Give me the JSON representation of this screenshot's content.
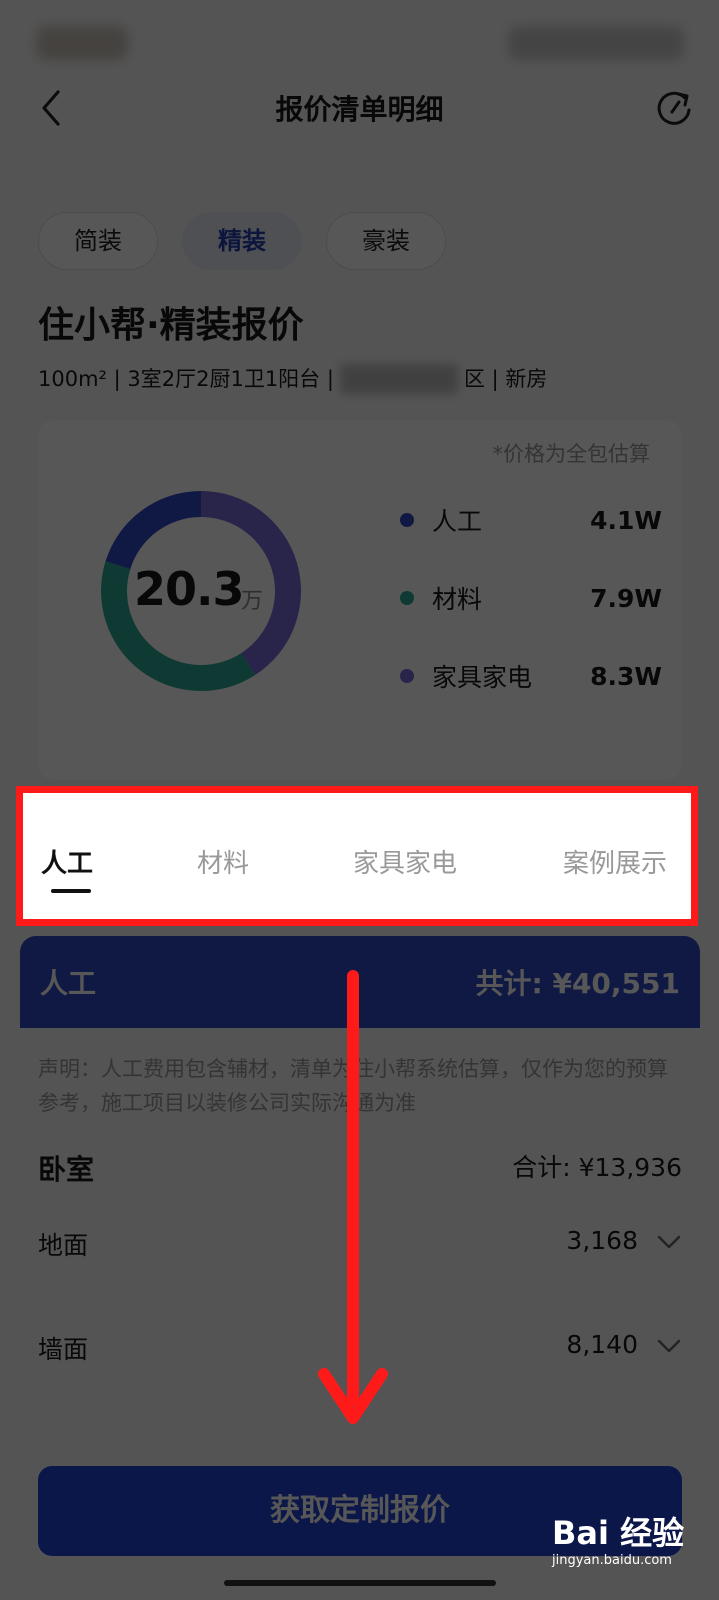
{
  "header": {
    "title": "报价清单明细"
  },
  "package_tabs": [
    {
      "label": "简装",
      "active": false
    },
    {
      "label": "精装",
      "active": true
    },
    {
      "label": "豪装",
      "active": false
    }
  ],
  "quote": {
    "title": "住小帮·精装报价",
    "area": "100m² | 3室2厅2厨1卫1阳台 |",
    "district_suffix": "区 | 新房"
  },
  "summary": {
    "note": "*价格为全包估算",
    "total_value": "20.3",
    "total_unit": "万",
    "legend": [
      {
        "name": "人工",
        "value": "4.1W",
        "amount": 4.1,
        "color": "#3048c8"
      },
      {
        "name": "材料",
        "value": "7.9W",
        "amount": 7.9,
        "color": "#2ea896"
      },
      {
        "name": "家具家电",
        "value": "8.3W",
        "amount": 8.3,
        "color": "#7a6ad8"
      }
    ]
  },
  "category_tabs": [
    {
      "label": "人工",
      "active": true
    },
    {
      "label": "材料",
      "active": false
    },
    {
      "label": "家具家电",
      "active": false
    },
    {
      "label": "案例展示",
      "active": false
    }
  ],
  "section": {
    "name": "人工",
    "total": "共计: ¥40,551",
    "disclaimer": "声明：人工费用包含辅材，清单为住小帮系统估算，仅作为您的预算参考，施工项目以装修公司实际沟通为准"
  },
  "room": {
    "name": "卧室",
    "total": "合计: ¥13,936"
  },
  "items": [
    {
      "name": "地面",
      "value": "3,168"
    },
    {
      "name": "墙面",
      "value": "8,140"
    }
  ],
  "cta": {
    "label": "获取定制报价"
  },
  "watermark": {
    "logo": "Bai 经验",
    "url": "jingyan.baidu.com"
  },
  "colors": {
    "primary": "#2240d6",
    "highlight": "#ff1a1a",
    "annotation_arrow": "#ff1a1a"
  }
}
